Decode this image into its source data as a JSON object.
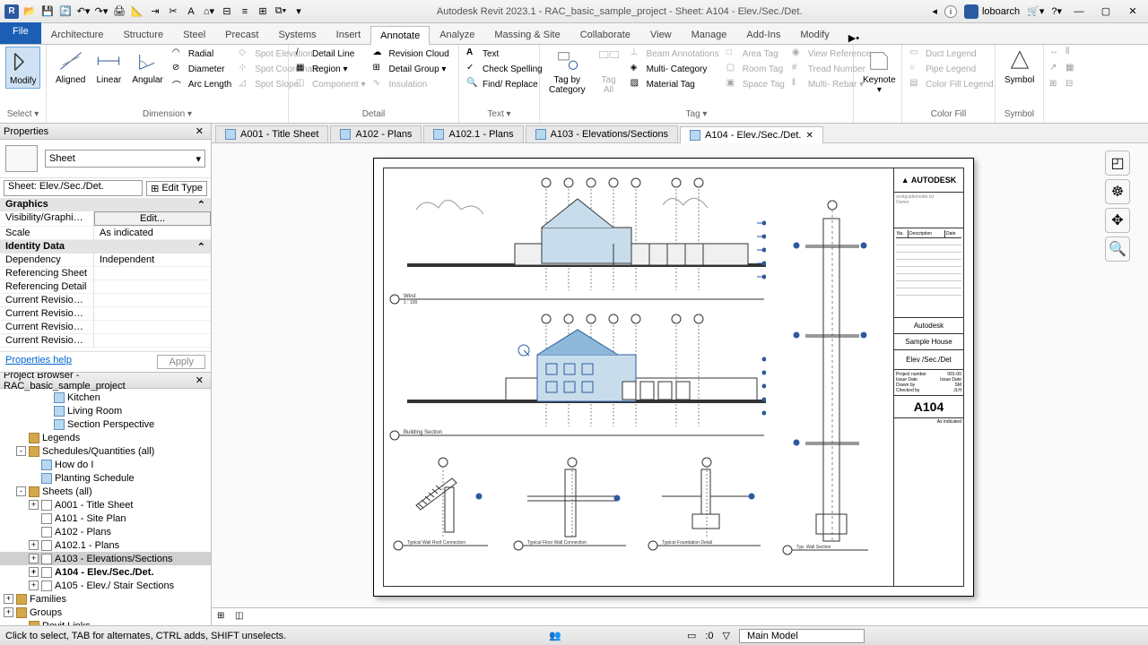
{
  "title": "Autodesk Revit 2023.1 - RAC_basic_sample_project - Sheet: A104 - Elev./Sec./Det.",
  "user": "loboarch",
  "ribbon": {
    "file": "File",
    "tabs": [
      "Architecture",
      "Structure",
      "Steel",
      "Precast",
      "Systems",
      "Insert",
      "Annotate",
      "Analyze",
      "Massing & Site",
      "Collaborate",
      "View",
      "Manage",
      "Add-Ins",
      "Modify"
    ],
    "active_tab": "Annotate",
    "panels": {
      "select": {
        "modify": "Modify",
        "label": "Select ▾"
      },
      "dimension": {
        "aligned": "Aligned",
        "linear": "Linear",
        "angular": "Angular",
        "radial": "Radial",
        "diameter": "Diameter",
        "arc": "Arc  Length",
        "spot_elev": "Spot  Elevation",
        "spot_coord": "Spot  Coordinate",
        "spot_slope": "Spot  Slope",
        "label": "Dimension ▾"
      },
      "detail": {
        "detail_line": "Detail  Line",
        "region": "Region ▾",
        "component": "Component ▾",
        "revision_cloud": "Revision  Cloud",
        "detail_group": "Detail  Group ▾",
        "insulation": "Insulation",
        "label": "Detail"
      },
      "text": {
        "text": "Text",
        "check_spelling": "Check  Spelling",
        "find_replace": "Find/  Replace",
        "label": "Text ▾"
      },
      "tag": {
        "tag_by_cat": "Tag by\nCategory",
        "tag_all": "Tag\nAll",
        "beam_anno": "Beam  Annotations",
        "multi_cat": "Multi-  Category",
        "material": "Material  Tag",
        "area_tag": "Area  Tag",
        "room_tag": "Room  Tag",
        "space_tag": "Space  Tag",
        "view_ref": "View  Reference",
        "tread_num": "Tread  Number",
        "multi_rebar": "Multi-  Rebar ▾",
        "label": "Tag ▾"
      },
      "keynote": {
        "keynote": "Keynote",
        "label": ""
      },
      "colorfill": {
        "duct": "Duct  Legend",
        "pipe": "Pipe  Legend",
        "color": "Color Fill  Legend",
        "label": "Color Fill"
      },
      "symbol": {
        "symbol": "Symbol",
        "label": "Symbol"
      }
    }
  },
  "view_tabs": [
    {
      "label": "A001 - Title Sheet",
      "active": false
    },
    {
      "label": "A102 - Plans",
      "active": false
    },
    {
      "label": "A102.1 - Plans",
      "active": false
    },
    {
      "label": "A103 - Elevations/Sections",
      "active": false
    },
    {
      "label": "A104 - Elev./Sec./Det.",
      "active": true
    }
  ],
  "properties": {
    "title": "Properties",
    "type_name": "Sheet",
    "instance": "Sheet: Elev./Sec./Det.",
    "edit_type": "Edit Type",
    "groups": [
      {
        "name": "Graphics",
        "rows": [
          {
            "n": "Visibility/Graphics O...",
            "v": "Edit...",
            "btn": true
          },
          {
            "n": "Scale",
            "v": "As indicated"
          }
        ]
      },
      {
        "name": "Identity Data",
        "rows": [
          {
            "n": "Dependency",
            "v": "Independent"
          },
          {
            "n": "Referencing Sheet",
            "v": ""
          },
          {
            "n": "Referencing Detail",
            "v": ""
          },
          {
            "n": "Current Revision Issu...",
            "v": ""
          },
          {
            "n": "Current Revision Issu...",
            "v": ""
          },
          {
            "n": "Current Revision Issu...",
            "v": ""
          },
          {
            "n": "Current Revision Date",
            "v": ""
          }
        ]
      }
    ],
    "help": "Properties help",
    "apply": "Apply"
  },
  "browser": {
    "title": "Project Browser - RAC_basic_sample_project",
    "items": [
      {
        "indent": 3,
        "icon": "view",
        "label": "Kitchen"
      },
      {
        "indent": 3,
        "icon": "view",
        "label": "Living Room"
      },
      {
        "indent": 3,
        "icon": "view",
        "label": "Section Perspective"
      },
      {
        "indent": 1,
        "icon": "folder",
        "label": "Legends"
      },
      {
        "indent": 1,
        "toggle": "-",
        "icon": "folder",
        "label": "Schedules/Quantities (all)"
      },
      {
        "indent": 2,
        "icon": "view",
        "label": "How do I"
      },
      {
        "indent": 2,
        "icon": "view",
        "label": "Planting Schedule"
      },
      {
        "indent": 1,
        "toggle": "-",
        "icon": "folder",
        "label": "Sheets (all)"
      },
      {
        "indent": 2,
        "toggle": "+",
        "icon": "sheet",
        "label": "A001 - Title Sheet"
      },
      {
        "indent": 2,
        "icon": "sheet",
        "label": "A101 - Site Plan"
      },
      {
        "indent": 2,
        "icon": "sheet",
        "label": "A102 - Plans"
      },
      {
        "indent": 2,
        "toggle": "+",
        "icon": "sheet",
        "label": "A102.1 - Plans"
      },
      {
        "indent": 2,
        "toggle": "+",
        "icon": "sheet",
        "label": "A103 - Elevations/Sections",
        "selected": true
      },
      {
        "indent": 2,
        "toggle": "+",
        "icon": "sheet",
        "label": "A104 - Elev./Sec./Det.",
        "bold": true
      },
      {
        "indent": 2,
        "toggle": "+",
        "icon": "sheet",
        "label": "A105 - Elev./ Stair Sections"
      },
      {
        "indent": 0,
        "toggle": "+",
        "icon": "folder",
        "label": "Families"
      },
      {
        "indent": 0,
        "toggle": "+",
        "icon": "folder",
        "label": "Groups"
      },
      {
        "indent": 1,
        "icon": "folder",
        "label": "Revit Links"
      }
    ]
  },
  "titleblock": {
    "logo": "▲ AUTODESK",
    "rev_headers": [
      "No.",
      "Description",
      "Date"
    ],
    "owner": "Autodesk",
    "project": "Sample House",
    "sheet_name": "Elev /Sec./Det",
    "proj_no_label": "Project number",
    "proj_no": "001-00",
    "date_label": "Issue Date",
    "date": "Issue Date",
    "drawn_label": "Drawn by",
    "drawn": "SM",
    "checked_label": "Checked by",
    "checked": "JLH",
    "sheet_num": "A104",
    "scale": "As indicated"
  },
  "drawings": {
    "west": "West",
    "west_scale": "1 : 100",
    "section": "Building Section",
    "wall_roof": "Typical Wall Roof\nConnection",
    "floor_wall": "Typical Floor Wall\nConnection",
    "foundation": "Typical Foundation Detail",
    "wall_section": "Typ. Wall Section"
  },
  "status": {
    "hint": "Click to select, TAB for alternates, CTRL adds, SHIFT unselects.",
    "sel_count": ":0",
    "workset": "Main Model"
  }
}
